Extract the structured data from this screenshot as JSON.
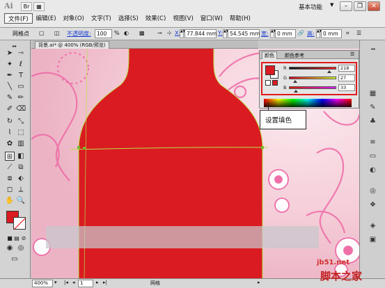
{
  "app": {
    "logo": "Ai",
    "workspace": "基本功能"
  },
  "menu": [
    "文件(F)",
    "编辑(E)",
    "对象(O)",
    "文字(T)",
    "选择(S)",
    "效果(C)",
    "视图(V)",
    "窗口(W)",
    "帮助(H)"
  ],
  "control_bar": {
    "anchor_label": "网格点",
    "opacity_label": "不透明度:",
    "opacity_value": "100",
    "percent": "%",
    "x_label": "X:",
    "x_value": "77.844 mm",
    "y_label": "Y:",
    "y_value": "54.545 mm",
    "w_label": "宽:",
    "w_value": "0 mm",
    "h_label": "高:",
    "h_value": "0 mm"
  },
  "document": {
    "tab_label": "背景.ai* @ 400% (RGB/预览)"
  },
  "color_panel": {
    "tab_color": "颜色",
    "tab_guide": "颜色参考",
    "r_label": "R",
    "g_label": "G",
    "b_label": "B",
    "r_value": "218",
    "g_value": "27",
    "b_value": "33",
    "fill_color": "#da1b21"
  },
  "callout": {
    "text": "设置填色"
  },
  "status_bar": {
    "zoom": "400%",
    "page": "1",
    "tool": "网格"
  },
  "watermark": {
    "url": "jb51.net",
    "site": "脚本之家"
  },
  "colors": {
    "fill": "#da1b21",
    "canvas_pink": "#f3cad4",
    "highlight": "#e21a1a",
    "link": "#1a3fd1"
  }
}
